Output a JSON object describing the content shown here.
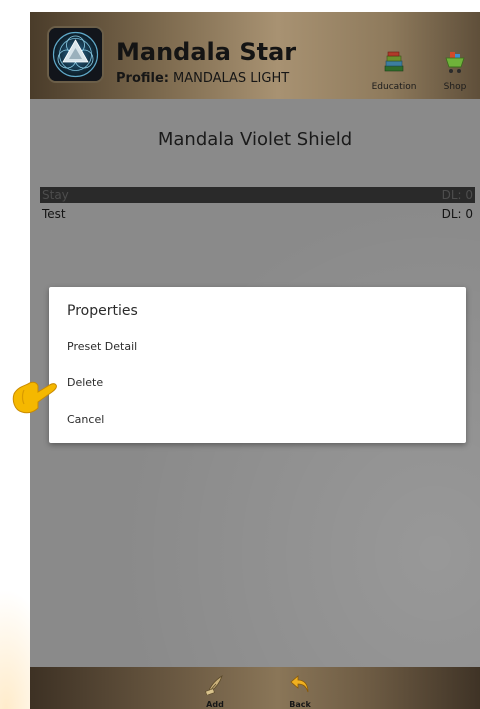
{
  "header": {
    "app_title": "Mandala Star",
    "profile_label": "Profile:",
    "profile_value": "MANDALAS LIGHT",
    "education_label": "Education",
    "shop_label": "Shop"
  },
  "main": {
    "title": "Mandala Violet Shield",
    "presets": [
      {
        "name": "Stay",
        "dl": "DL: 0"
      },
      {
        "name": "Test",
        "dl": "DL: 0"
      }
    ]
  },
  "dialog": {
    "title": "Properties",
    "options": [
      "Preset Detail",
      "Delete",
      "Cancel"
    ]
  },
  "bottom_bar": {
    "add_label": "Add",
    "back_label": "Back"
  },
  "colors": {
    "header_accent": "#a89272",
    "content_bg": "#8a8a8a",
    "selected_row_bg": "#2a2a2a",
    "dialog_bg": "#ffffff",
    "pointer_hand": "#f5b800"
  }
}
